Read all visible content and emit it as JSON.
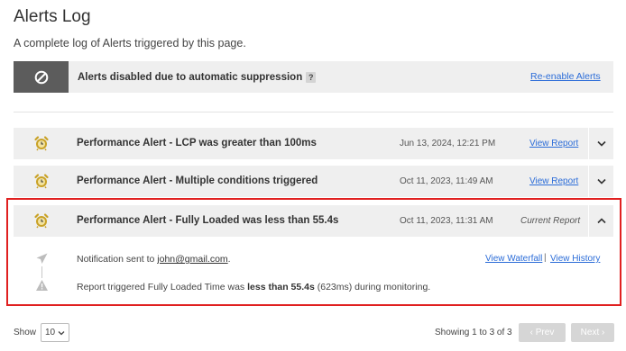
{
  "page": {
    "title": "Alerts Log",
    "subtitle": "A complete log of Alerts triggered by this page."
  },
  "suppression": {
    "icon": "no-entry-icon",
    "message": "Alerts disabled due to automatic suppression",
    "help": "?",
    "reenable_label": "Re-enable Alerts"
  },
  "alerts": [
    {
      "icon": "alarm-clock-icon",
      "title": "Performance Alert - LCP was greater than 100ms",
      "date": "Jun 13, 2024, 12:21 PM",
      "action": "View Report",
      "expanded": false
    },
    {
      "icon": "alarm-clock-icon",
      "title": "Performance Alert - Multiple conditions triggered",
      "date": "Oct 11, 2023, 11:49 AM",
      "action": "View Report",
      "expanded": false
    },
    {
      "icon": "alarm-clock-icon",
      "title": "Performance Alert - Fully Loaded was less than 55.4s",
      "date": "Oct 11, 2023, 11:31 AM",
      "action": "Current Report",
      "expanded": true
    }
  ],
  "details": {
    "notification_prefix": "Notification sent to ",
    "email": "john@gmail.com",
    "notification_suffix": ".",
    "report_prefix": "Report triggered Fully Loaded Time was ",
    "report_bold": "less than 55.4s",
    "report_suffix": " (623ms) during monitoring.",
    "view_waterfall": "View Waterfall",
    "separator": "|",
    "view_history": "View History"
  },
  "footer": {
    "show_label": "Show",
    "page_size": "10",
    "showing": "Showing 1 to 3 of 3",
    "prev": "‹ Prev",
    "next": "Next ›"
  },
  "colors": {
    "link": "#2b6cd8",
    "alarm": "#c9a227",
    "highlight_border": "#e02020",
    "row_bg": "#efefef"
  }
}
